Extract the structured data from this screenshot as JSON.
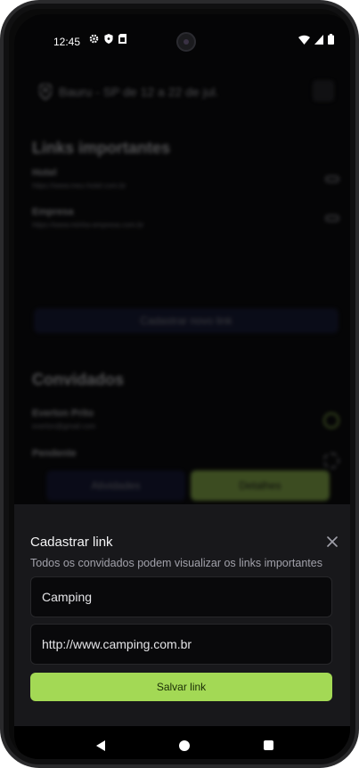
{
  "status": {
    "time": "12:45"
  },
  "background": {
    "location": "Bauru - SP de 12 a 22 de jul.",
    "links_title": "Links importantes",
    "links": [
      {
        "title": "Hotel",
        "url": "https://www.meu-hotel.com.br"
      },
      {
        "title": "Empresa",
        "url": "https://www.minha-empresa.com.br"
      }
    ],
    "add_link_label": "Cadastrar novo link",
    "guests_title": "Convidados",
    "guests": [
      {
        "name": "Everton Prito",
        "email": "everton@gmail.com"
      },
      {
        "name": "Pendente",
        "email": ""
      }
    ],
    "tab_activities": "Atividades",
    "tab_details": "Detalhes"
  },
  "sheet": {
    "title": "Cadastrar link",
    "description": "Todos os convidados podem visualizar os links importantes",
    "title_value": "Camping",
    "url_value": "http://www.camping.com.br",
    "save_label": "Salvar link"
  },
  "colors": {
    "accent": "#a3d955",
    "sheet_bg": "#18181b",
    "field_bg": "#09090b"
  }
}
